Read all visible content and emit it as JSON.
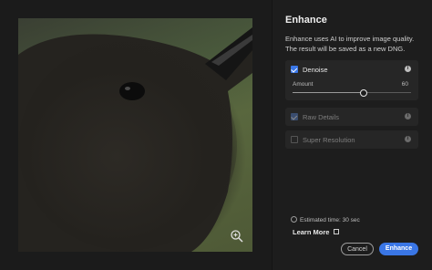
{
  "panel": {
    "title": "Enhance",
    "description": "Enhance uses AI to improve image quality. The result will be saved as a new DNG."
  },
  "options": {
    "denoise": {
      "label": "Denoise",
      "checked": true,
      "amount_label": "Amount",
      "amount_value": "60",
      "amount": 60,
      "max": 100
    },
    "raw_details": {
      "label": "Raw Details",
      "checked": true,
      "disabled": true
    },
    "super_resolution": {
      "label": "Super Resolution",
      "checked": false,
      "disabled": true
    }
  },
  "footer": {
    "estimated_time": "Estimated time: 30 sec",
    "learn_more": "Learn More",
    "cancel_label": "Cancel",
    "enhance_label": "Enhance"
  },
  "colors": {
    "accent": "#3a76e5",
    "panel_bg": "#1d1d1d",
    "option_bg": "#262626"
  },
  "icons": {
    "zoom": "zoom-in-icon",
    "info": "info-icon",
    "external": "external-link-icon",
    "clock": "clock-icon"
  }
}
